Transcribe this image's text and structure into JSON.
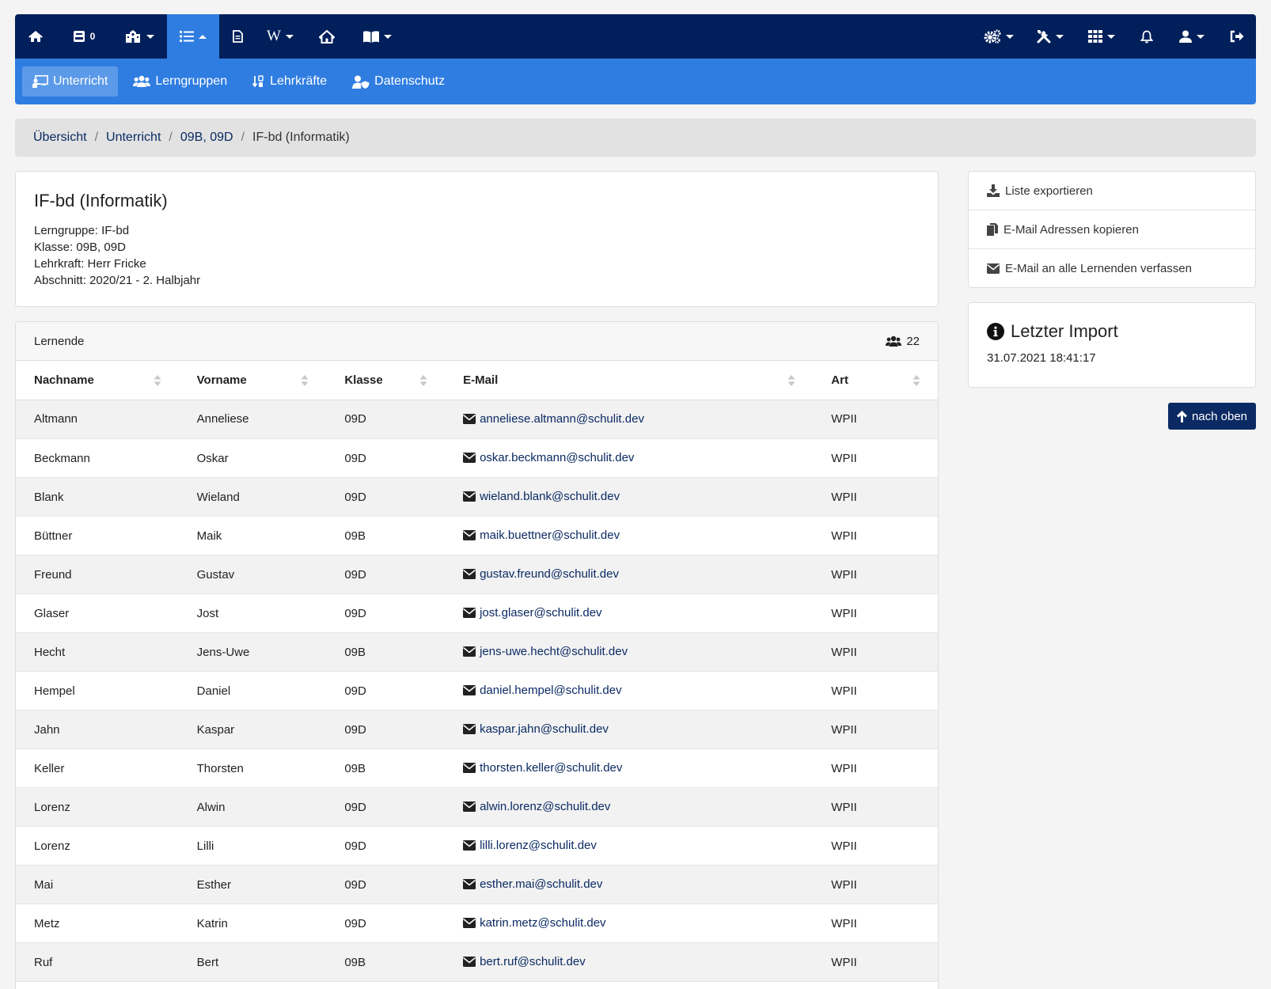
{
  "topnav": {
    "left": [
      {
        "name": "home-icon",
        "caret": false
      },
      {
        "name": "inbox-icon",
        "badge": "0",
        "caret": false
      },
      {
        "name": "school-icon",
        "caret": true
      },
      {
        "name": "list-icon",
        "caret": true,
        "active": true
      },
      {
        "name": "document-icon",
        "caret": false
      },
      {
        "name": "wiki-icon",
        "text": "W",
        "caret": true
      },
      {
        "name": "house-icon",
        "caret": false
      },
      {
        "name": "book-icon",
        "caret": true
      }
    ],
    "right": [
      "cogs-icon",
      "tools-icon",
      "grid-icon",
      "bell-icon",
      "user-icon",
      "logout-icon"
    ]
  },
  "subnav": {
    "items": [
      {
        "label": "Unterricht",
        "icon": "chalkboard-teacher-icon",
        "active": true
      },
      {
        "label": "Lerngruppen",
        "icon": "users-icon"
      },
      {
        "label": "Lehrkräfte",
        "icon": "sort-icon"
      },
      {
        "label": "Datenschutz",
        "icon": "user-shield-icon"
      }
    ]
  },
  "breadcrumb": {
    "items": [
      "Übersicht",
      "Unterricht",
      "09B, 09D"
    ],
    "current": "IF-bd (Informatik)"
  },
  "info": {
    "title": "IF-bd (Informatik)",
    "lines": [
      "Lerngruppe: IF-bd",
      "Klasse: 09B, 09D",
      "Lehrkraft: Herr Fricke",
      "Abschnitt: 2020/21 - 2. Halbjahr"
    ]
  },
  "students": {
    "heading": "Lernende",
    "count": "22",
    "columns": [
      "Nachname",
      "Vorname",
      "Klasse",
      "E-Mail",
      "Art"
    ],
    "rows": [
      [
        "Altmann",
        "Anneliese",
        "09D",
        "anneliese.altmann@schulit.dev",
        "WPII"
      ],
      [
        "Beckmann",
        "Oskar",
        "09D",
        "oskar.beckmann@schulit.dev",
        "WPII"
      ],
      [
        "Blank",
        "Wieland",
        "09D",
        "wieland.blank@schulit.dev",
        "WPII"
      ],
      [
        "Büttner",
        "Maik",
        "09B",
        "maik.buettner@schulit.dev",
        "WPII"
      ],
      [
        "Freund",
        "Gustav",
        "09D",
        "gustav.freund@schulit.dev",
        "WPII"
      ],
      [
        "Glaser",
        "Jost",
        "09D",
        "jost.glaser@schulit.dev",
        "WPII"
      ],
      [
        "Hecht",
        "Jens-Uwe",
        "09B",
        "jens-uwe.hecht@schulit.dev",
        "WPII"
      ],
      [
        "Hempel",
        "Daniel",
        "09D",
        "daniel.hempel@schulit.dev",
        "WPII"
      ],
      [
        "Jahn",
        "Kaspar",
        "09D",
        "kaspar.jahn@schulit.dev",
        "WPII"
      ],
      [
        "Keller",
        "Thorsten",
        "09B",
        "thorsten.keller@schulit.dev",
        "WPII"
      ],
      [
        "Lorenz",
        "Alwin",
        "09D",
        "alwin.lorenz@schulit.dev",
        "WPII"
      ],
      [
        "Lorenz",
        "Lilli",
        "09D",
        "lilli.lorenz@schulit.dev",
        "WPII"
      ],
      [
        "Mai",
        "Esther",
        "09D",
        "esther.mai@schulit.dev",
        "WPII"
      ],
      [
        "Metz",
        "Katrin",
        "09D",
        "katrin.metz@schulit.dev",
        "WPII"
      ],
      [
        "Ruf",
        "Bert",
        "09B",
        "bert.ruf@schulit.dev",
        "WPII"
      ]
    ]
  },
  "actions": [
    {
      "label": "Liste exportieren",
      "icon": "download-icon"
    },
    {
      "label": "E-Mail Adressen kopieren",
      "icon": "copy-icon"
    },
    {
      "label": "E-Mail an alle Lernenden verfassen",
      "icon": "envelope-icon"
    }
  ],
  "import": {
    "title": "Letzter Import",
    "timestamp": "31.07.2021 18:41:17"
  },
  "top_button": {
    "label": "nach oben"
  },
  "colors": {
    "navbar": "#001f5b",
    "subnav": "#2f7de1",
    "link": "#0b2a63",
    "button": "#0b2a63"
  }
}
